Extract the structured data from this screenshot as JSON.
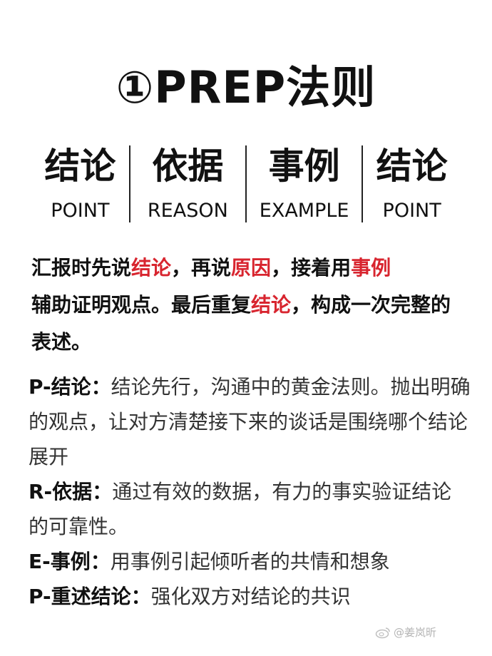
{
  "title": "①PREP法则",
  "columns": [
    {
      "cn": "结论",
      "en": "POINT"
    },
    {
      "cn": "依据",
      "en": "REASON"
    },
    {
      "cn": "事例",
      "en": "EXAMPLE"
    },
    {
      "cn": "结论",
      "en": "POINT"
    }
  ],
  "summary": {
    "s1": "汇报时先说",
    "h1": "结论",
    "s2": "，再说",
    "h2": "原因",
    "s3": "，接着用",
    "h3": "事例",
    "s4": "辅助证明观点。最后重复",
    "h4": "结论",
    "s5": "，构成一次完整的表述。"
  },
  "details": [
    {
      "key": "P-结论：",
      "text": "结论先行，沟通中的黄金法则。抛出明确的观点，让对方清楚接下来的谈话是围绕哪个结论展开"
    },
    {
      "key": "R-依据：",
      "text": "通过有效的数据，有力的事实验证结论的可靠性。"
    },
    {
      "key": "E-事例：",
      "text": "用事例引起倾听者的共情和想象"
    },
    {
      "key": "P-重述结论：",
      "text": "强化双方对结论的共识"
    }
  ],
  "watermark": "@姜岚昕",
  "colors": {
    "highlight": "#d8252f",
    "text": "#111111",
    "detail_text": "#333333",
    "watermark": "#b4b4b4"
  },
  "icons": {
    "watermark": "weibo-icon"
  }
}
